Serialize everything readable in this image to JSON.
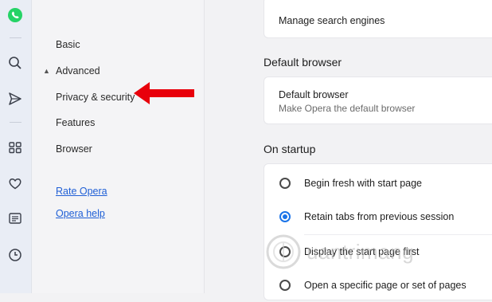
{
  "rail": {
    "icons": [
      "whatsapp-icon",
      "search-icon",
      "send-icon",
      "grid-icon",
      "heart-icon",
      "news-icon",
      "clock-icon"
    ],
    "whatsapp_color": "#25d366"
  },
  "nav": {
    "basic": "Basic",
    "advanced": "Advanced",
    "advanced_caret": "▲",
    "privacy": "Privacy & security",
    "features": "Features",
    "browser": "Browser",
    "rate": "Rate Opera",
    "help": "Opera help"
  },
  "main": {
    "manage_search_engines": "Manage search engines",
    "default_browser_section": "Default browser",
    "default_browser_title": "Default browser",
    "default_browser_sub": "Make Opera the default browser",
    "on_startup_section": "On startup",
    "startup_options": [
      {
        "label": "Begin fresh with start page",
        "checked": false
      },
      {
        "label": "Retain tabs from previous session",
        "checked": true
      },
      {
        "label": "Display the start page first",
        "checked": false
      },
      {
        "label": "Open a specific page or set of pages",
        "checked": false
      }
    ]
  },
  "watermark": {
    "text": "uantrimang"
  },
  "colors": {
    "accent": "#1a73e8",
    "arrow": "#e8000b"
  }
}
